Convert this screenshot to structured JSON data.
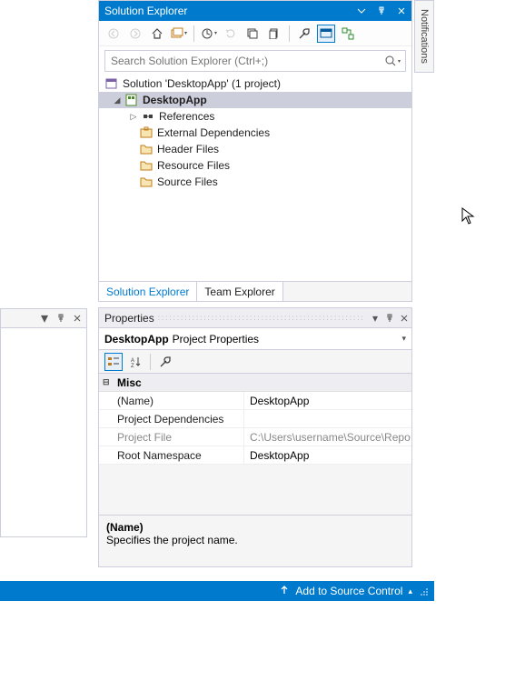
{
  "solution_explorer": {
    "title": "Solution Explorer",
    "search_placeholder": "Search Solution Explorer (Ctrl+;)",
    "solution_label": "Solution 'DesktopApp' (1 project)",
    "project_label": "DesktopApp",
    "nodes": {
      "references": "References",
      "external_deps": "External Dependencies",
      "header_files": "Header Files",
      "resource_files": "Resource Files",
      "source_files": "Source Files"
    },
    "tabs": {
      "solution": "Solution Explorer",
      "team": "Team Explorer"
    }
  },
  "notifications_tab": "Notifications",
  "properties": {
    "title": "Properties",
    "selector_name": "DesktopApp",
    "selector_type": "Project Properties",
    "category": "Misc",
    "rows": {
      "name": {
        "label": "(Name)",
        "value": "DesktopApp"
      },
      "deps": {
        "label": "Project Dependencies",
        "value": ""
      },
      "file": {
        "label": "Project File",
        "value": "C:\\Users\\username\\Source\\Repo"
      },
      "rootns": {
        "label": "Root Namespace",
        "value": "DesktopApp"
      }
    },
    "desc_name": "(Name)",
    "desc_text": "Specifies the project name."
  },
  "statusbar": {
    "source_control": "Add to Source Control"
  }
}
